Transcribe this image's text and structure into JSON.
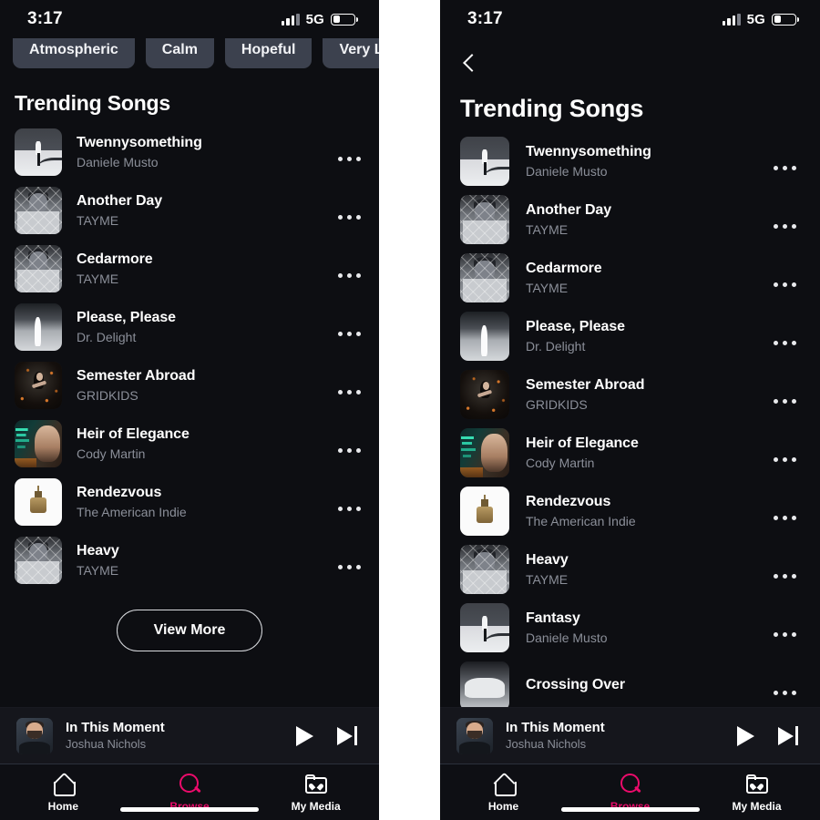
{
  "status": {
    "time": "3:17",
    "network": "5G"
  },
  "chips": [
    {
      "label": "Atmospheric"
    },
    {
      "label": "Calm"
    },
    {
      "label": "Hopeful"
    },
    {
      "label": "Very Low"
    }
  ],
  "section": {
    "title": "Trending Songs"
  },
  "buttons": {
    "view_more": "View More"
  },
  "songs_left": [
    {
      "title": "Twennysomething",
      "artist": "Daniele Musto",
      "art": "aw-snow"
    },
    {
      "title": "Another Day",
      "artist": "TAYME",
      "art": "aw-fence"
    },
    {
      "title": "Cedarmore",
      "artist": "TAYME",
      "art": "aw-fence"
    },
    {
      "title": "Please, Please",
      "artist": "Dr. Delight",
      "art": "aw-beach"
    },
    {
      "title": "Semester Abroad",
      "artist": "GRIDKIDS",
      "art": "aw-dark"
    },
    {
      "title": "Heir of Elegance",
      "artist": "Cody Martin",
      "art": "aw-neon"
    },
    {
      "title": "Rendezvous",
      "artist": "The American Indie",
      "art": "aw-white"
    },
    {
      "title": "Heavy",
      "artist": "TAYME",
      "art": "aw-fence"
    }
  ],
  "songs_right": [
    {
      "title": "Twennysomething",
      "artist": "Daniele Musto",
      "art": "aw-snow"
    },
    {
      "title": "Another Day",
      "artist": "TAYME",
      "art": "aw-fence"
    },
    {
      "title": "Cedarmore",
      "artist": "TAYME",
      "art": "aw-fence"
    },
    {
      "title": "Please, Please",
      "artist": "Dr. Delight",
      "art": "aw-beach"
    },
    {
      "title": "Semester Abroad",
      "artist": "GRIDKIDS",
      "art": "aw-dark"
    },
    {
      "title": "Heir of Elegance",
      "artist": "Cody Martin",
      "art": "aw-neon"
    },
    {
      "title": "Rendezvous",
      "artist": "The American Indie",
      "art": "aw-white"
    },
    {
      "title": "Heavy",
      "artist": "TAYME",
      "art": "aw-fence"
    },
    {
      "title": "Fantasy",
      "artist": "Daniele Musto",
      "art": "aw-snow"
    },
    {
      "title": "Crossing Over",
      "artist": "",
      "art": "aw-car"
    }
  ],
  "player": {
    "title": "In This Moment",
    "artist": "Joshua Nichols",
    "play_icon": "play-icon",
    "next_icon": "next-track-icon"
  },
  "tabs": [
    {
      "label": "Home",
      "icon": "home-icon",
      "active": false
    },
    {
      "label": "Browse",
      "icon": "search-icon",
      "active": true
    },
    {
      "label": "My Media",
      "icon": "folder-heart-icon",
      "active": false
    }
  ],
  "colors": {
    "accent": "#ec0b6b",
    "background": "#0d0e12",
    "surface": "#15161c",
    "chip": "#3c414e",
    "text_primary": "#ffffff",
    "text_secondary": "#8b8f99"
  }
}
